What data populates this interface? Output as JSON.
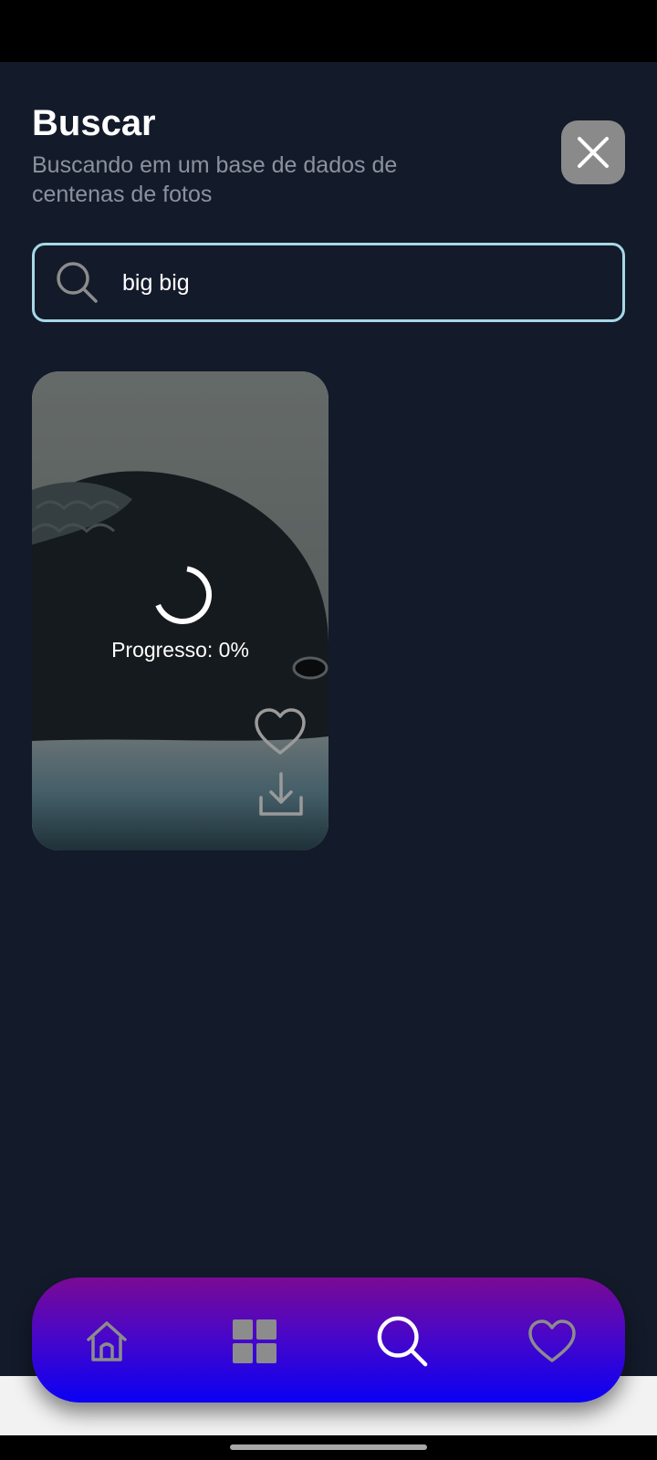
{
  "header": {
    "title": "Buscar",
    "subtitle": "Buscando em um base de dados de centenas de fotos"
  },
  "close_button": {
    "icon": "close-icon"
  },
  "search": {
    "icon": "search-icon",
    "value": "big big",
    "placeholder": ""
  },
  "results": [
    {
      "progress_text": "Progresso: 0%",
      "progress": 0,
      "actions": [
        "heart-outline-icon",
        "download-icon"
      ]
    }
  ],
  "bottom_nav": {
    "items": [
      {
        "name": "home",
        "icon": "home-icon",
        "active": false
      },
      {
        "name": "categories",
        "icon": "grid-icon",
        "active": false
      },
      {
        "name": "search",
        "icon": "search-icon",
        "active": true
      },
      {
        "name": "favorites",
        "icon": "heart-icon",
        "active": false
      }
    ]
  },
  "colors": {
    "background": "#131a2a",
    "search_border": "#a6d8e6",
    "subtitle": "#8b929e",
    "close_button": "#8a8a8a",
    "nav_gradient_top": "#7a0a93",
    "nav_gradient_bottom": "#0a00f4",
    "icon_inactive": "#8c8c8c",
    "icon_active": "#ffffff"
  }
}
